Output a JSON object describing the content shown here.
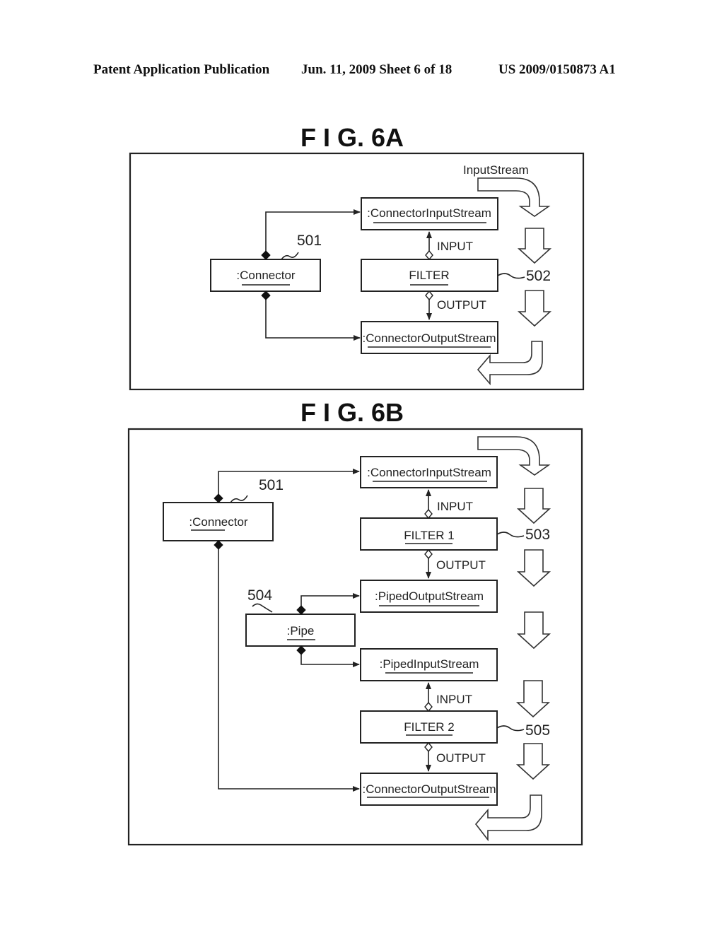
{
  "header": {
    "left": "Patent Application Publication",
    "center": "Jun. 11, 2009  Sheet 6 of 18",
    "right": "US 2009/0150873 A1"
  },
  "fig6a": {
    "title": "F I G.  6A",
    "stream_label": "InputStream",
    "connector": ":Connector",
    "connector_ref": "501",
    "input_stream": ":ConnectorInputStream",
    "filter": "FILTER",
    "filter_ref": "502",
    "output_stream": ":ConnectorOutputStream",
    "input_label": "INPUT",
    "output_label": "OUTPUT"
  },
  "fig6b": {
    "title": "F I G.  6B",
    "connector": ":Connector",
    "connector_ref": "501",
    "input_stream": ":ConnectorInputStream",
    "filter1": "FILTER 1",
    "filter1_ref": "503",
    "piped_output": ":PipedOutputStream",
    "pipe": ":Pipe",
    "pipe_ref": "504",
    "piped_input": ":PipedInputStream",
    "filter2": "FILTER 2",
    "filter2_ref": "505",
    "output_stream": ":ConnectorOutputStream",
    "input_label": "INPUT",
    "output_label": "OUTPUT"
  }
}
